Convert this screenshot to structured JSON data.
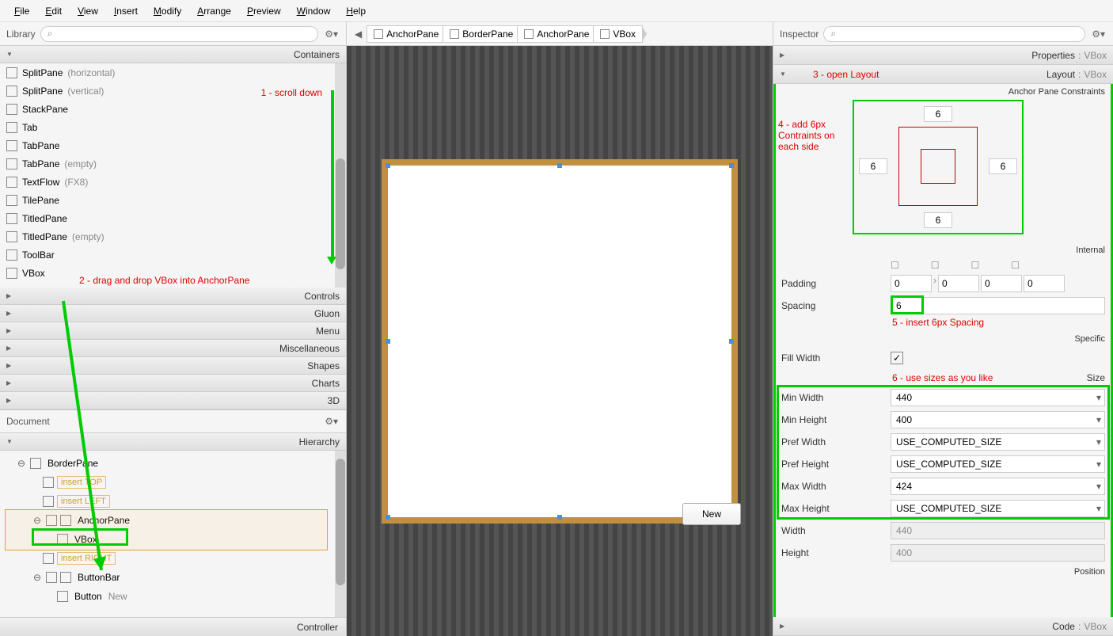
{
  "menubar": [
    "File",
    "Edit",
    "View",
    "Insert",
    "Modify",
    "Arrange",
    "Preview",
    "Window",
    "Help"
  ],
  "library": {
    "title": "Library",
    "sections": {
      "containers": "Containers",
      "controls": "Controls",
      "gluon": "Gluon",
      "menu": "Menu",
      "misc": "Miscellaneous",
      "shapes": "Shapes",
      "charts": "Charts",
      "threeD": "3D"
    },
    "items": [
      {
        "name": "SplitPane",
        "suffix": "(horizontal)"
      },
      {
        "name": "SplitPane",
        "suffix": "(vertical)"
      },
      {
        "name": "StackPane",
        "suffix": ""
      },
      {
        "name": "Tab",
        "suffix": ""
      },
      {
        "name": "TabPane",
        "suffix": ""
      },
      {
        "name": "TabPane",
        "suffix": "(empty)"
      },
      {
        "name": "TextFlow",
        "suffix": "(FX8)"
      },
      {
        "name": "TilePane",
        "suffix": ""
      },
      {
        "name": "TitledPane",
        "suffix": ""
      },
      {
        "name": "TitledPane",
        "suffix": "(empty)"
      },
      {
        "name": "ToolBar",
        "suffix": ""
      },
      {
        "name": "VBox",
        "suffix": ""
      }
    ]
  },
  "document": {
    "title": "Document",
    "hierarchy_label": "Hierarchy",
    "tree": {
      "borderpane": "BorderPane",
      "insert_top": "insert TOP",
      "insert_left": "insert LEFT",
      "anchorpane": "AnchorPane",
      "vbox": "VBox",
      "insert_right": "insert RIGHT",
      "buttonbar": "ButtonBar",
      "button": "Button",
      "button_new": "New"
    },
    "controller_label": "Controller"
  },
  "breadcrumb": [
    "AnchorPane",
    "BorderPane",
    "AnchorPane",
    "VBox"
  ],
  "canvas": {
    "new_button": "New"
  },
  "inspector": {
    "title": "Inspector",
    "properties_label": "Properties",
    "layout_label": "Layout",
    "code_label": "Code",
    "vbox_suffix": "VBox",
    "anchor_title": "Anchor Pane Constraints",
    "internal_title": "Internal",
    "specific_title": "Specific",
    "size_title": "Size",
    "position_title": "Position",
    "anchors": {
      "top": "6",
      "right": "6",
      "bottom": "6",
      "left": "6"
    },
    "padding_label": "Padding",
    "padding": {
      "top": "0",
      "right": "0",
      "bottom": "0",
      "left": "0"
    },
    "spacing_label": "Spacing",
    "spacing": "6",
    "fill_width_label": "Fill Width",
    "fill_width": true,
    "min_width_label": "Min Width",
    "min_width": "440",
    "min_height_label": "Min Height",
    "min_height": "400",
    "pref_width_label": "Pref Width",
    "pref_width": "USE_COMPUTED_SIZE",
    "pref_height_label": "Pref Height",
    "pref_height": "USE_COMPUTED_SIZE",
    "max_width_label": "Max Width",
    "max_width": "424",
    "max_height_label": "Max Height",
    "max_height": "USE_COMPUTED_SIZE",
    "width_label": "Width",
    "width": "440",
    "height_label": "Height",
    "height": "400"
  },
  "annotations": {
    "a1": "1 - scroll down",
    "a2": "2 - drag and drop VBox into AnchorPane",
    "a3": "3 - open Layout",
    "a4": "4 - add 6px Contraints on each side",
    "a5": "5 - insert 6px Spacing",
    "a6": "6 - use sizes as you like"
  }
}
